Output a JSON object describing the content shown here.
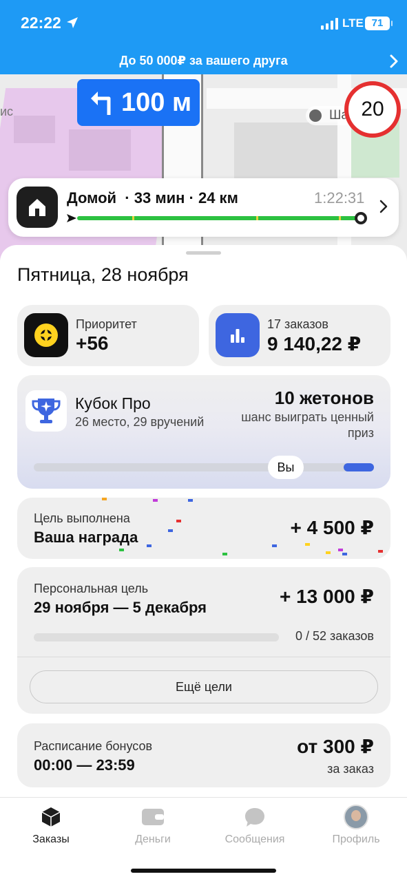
{
  "status_bar": {
    "time": "22:22",
    "network": "LTE",
    "battery": "71"
  },
  "promo": {
    "text": "До 50 000₽ за вашего друга"
  },
  "map": {
    "turn_distance": "100 м",
    "poi_label": "Ша",
    "partial_label": "ис",
    "speed_limit": "20"
  },
  "route": {
    "destination": "Домой",
    "duration": "33 мин",
    "distance": "24 км",
    "eta": "1:22:31"
  },
  "sheet": {
    "date": "Пятница, 28 ноября",
    "priority": {
      "label": "Приоритет",
      "value": "+56"
    },
    "orders": {
      "label": "17 заказов",
      "value": "9 140,22 ₽"
    },
    "cup": {
      "title": "Кубок Про",
      "subtitle": "26 место, 29 вручений",
      "tokens": "10 жетонов",
      "chance": "шанс выиграть ценный приз",
      "you_label": "Вы"
    },
    "goal_done": {
      "label": "Цель выполнена",
      "title": "Ваша награда",
      "amount": "+ 4 500 ₽"
    },
    "personal_goal": {
      "label": "Персональная цель",
      "period": "29 ноября — 5 декабря",
      "amount": "+ 13 000 ₽",
      "progress_text": "0 / 52 заказов",
      "progress": 0,
      "more_button": "Ещё цели"
    },
    "schedule": {
      "label": "Расписание бонусов",
      "time": "00:00 — 23:59",
      "amount": "от 300 ₽",
      "per": "за заказ"
    }
  },
  "tabs": [
    {
      "label": "Заказы",
      "icon": "cube-icon",
      "active": true
    },
    {
      "label": "Деньги",
      "icon": "wallet-icon",
      "active": false
    },
    {
      "label": "Сообщения",
      "icon": "chat-icon",
      "active": false
    },
    {
      "label": "Профиль",
      "icon": "avatar",
      "active": false
    }
  ],
  "colors": {
    "header_blue": "#1e9af5",
    "turn_blue": "#1a72f5",
    "route_green": "#2cc141",
    "speed_red": "#e53030",
    "priority_yellow": "#ffd21f",
    "orders_blue": "#3e66e0"
  }
}
